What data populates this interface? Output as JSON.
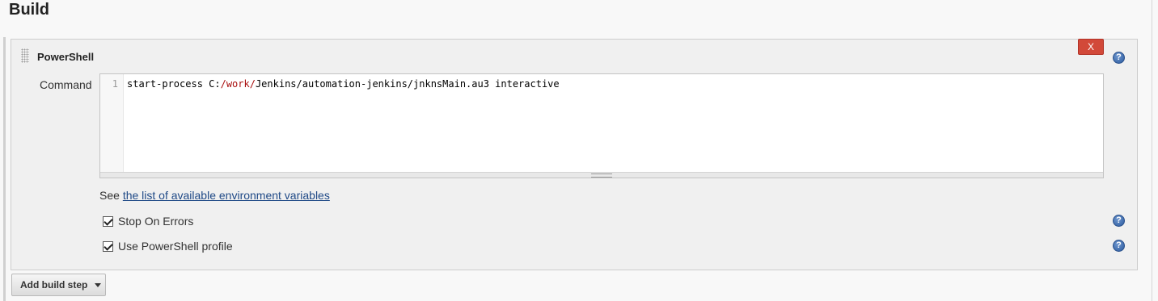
{
  "section": {
    "title": "Build"
  },
  "step": {
    "name": "PowerShell",
    "delete_label": "X",
    "help_glyph": "?",
    "command": {
      "label": "Command",
      "line_number": "1",
      "code_before": "start-process C:",
      "code_highlight": "/work/",
      "code_after": "Jenkins/automation-jenkins/jnknsMain.au3 interactive"
    },
    "env_note": {
      "prefix": "See ",
      "link_text": "the list of available environment variables"
    },
    "options": [
      {
        "label": "Stop On Errors",
        "checked": true
      },
      {
        "label": "Use PowerShell profile",
        "checked": true
      }
    ]
  },
  "add_build_step": {
    "label": "Add build step"
  },
  "icons": {
    "drag": "drag-handle-icon",
    "help": "help-icon",
    "dropdown": "chevron-down-icon",
    "check": "checkmark-icon"
  },
  "colors": {
    "delete_button": "#d24939",
    "link": "#204a87",
    "help_icon": "#2b5a9e",
    "panel_bg": "#f0f0f0"
  }
}
